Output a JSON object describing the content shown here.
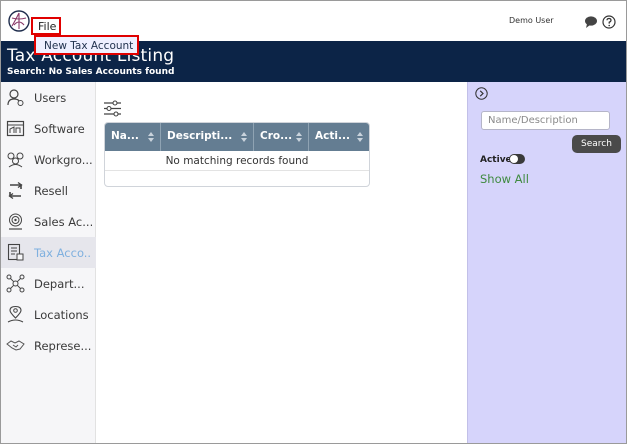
{
  "menu": {
    "file_label": "File",
    "file_items": [
      "New Tax Account"
    ]
  },
  "user": {
    "name": "Demo User"
  },
  "header": {
    "title": "Tax Account Listing",
    "subtitle": "Search: No Sales Accounts found"
  },
  "sidebar": {
    "items": [
      {
        "label": "Users",
        "icon": "user-icon"
      },
      {
        "label": "Software",
        "icon": "software-icon"
      },
      {
        "label": "Workgro...",
        "icon": "workgroup-icon"
      },
      {
        "label": "Resell",
        "icon": "resell-icon"
      },
      {
        "label": "Sales Ac...",
        "icon": "sales-account-icon"
      },
      {
        "label": "Tax Acco...",
        "icon": "tax-account-icon",
        "active": true
      },
      {
        "label": "Depart...",
        "icon": "department-icon"
      },
      {
        "label": "Locations",
        "icon": "location-icon"
      },
      {
        "label": "Represe...",
        "icon": "representative-icon"
      }
    ]
  },
  "table": {
    "columns": [
      "Na...",
      "Descripti...",
      "Cro...",
      "Acti..."
    ],
    "empty_message": "No matching records found"
  },
  "right_panel": {
    "search_placeholder": "Name/Description",
    "search_button": "Search",
    "active_label": "Active",
    "active_toggle_on": false,
    "show_all": "Show All"
  },
  "colors": {
    "header_bg": "#0c2447",
    "right_panel_bg": "#d6d4fb",
    "table_header_bg": "#647d92",
    "highlight_border": "#e00000",
    "active_nav_text": "#7fb0df",
    "show_all_text": "#3f8a3f"
  }
}
